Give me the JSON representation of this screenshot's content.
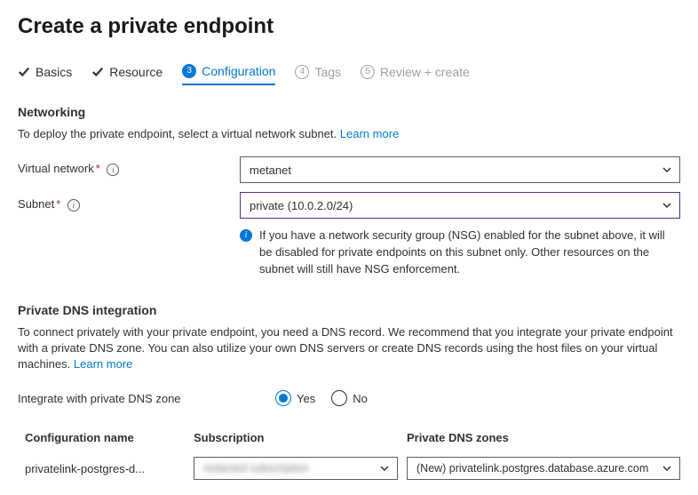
{
  "title": "Create a private endpoint",
  "steps": {
    "s1": "Basics",
    "s2": "Resource",
    "s3": "Configuration",
    "s3_num": "3",
    "s4": "Tags",
    "s4_num": "4",
    "s5": "Review + create",
    "s5_num": "5"
  },
  "networking": {
    "heading": "Networking",
    "desc": "To deploy the private endpoint, select a virtual network subnet.  ",
    "learn": "Learn more",
    "vnet_label": "Virtual network",
    "vnet_value": "metanet",
    "subnet_label": "Subnet",
    "subnet_value": "private (10.0.2.0/24)",
    "nsg_note": "If you have a network security group (NSG) enabled for the subnet above, it will be disabled for private endpoints on this subnet only. Other resources on the subnet will still have NSG enforcement."
  },
  "dns": {
    "heading": "Private DNS integration",
    "desc": "To connect privately with your private endpoint, you need a DNS record. We recommend that you integrate your private endpoint with a private DNS zone. You can also utilize your own DNS servers or create DNS records using the host files on your virtual machines.  ",
    "learn": "Learn more",
    "integrate_label": "Integrate with private DNS zone",
    "yes": "Yes",
    "no": "No",
    "col_config": "Configuration name",
    "col_sub": "Subscription",
    "col_zone": "Private DNS zones",
    "row": {
      "config": "privatelink-postgres-d...",
      "sub": "redacted subscription",
      "zone": "(New) privatelink.postgres.database.azure.com"
    }
  }
}
